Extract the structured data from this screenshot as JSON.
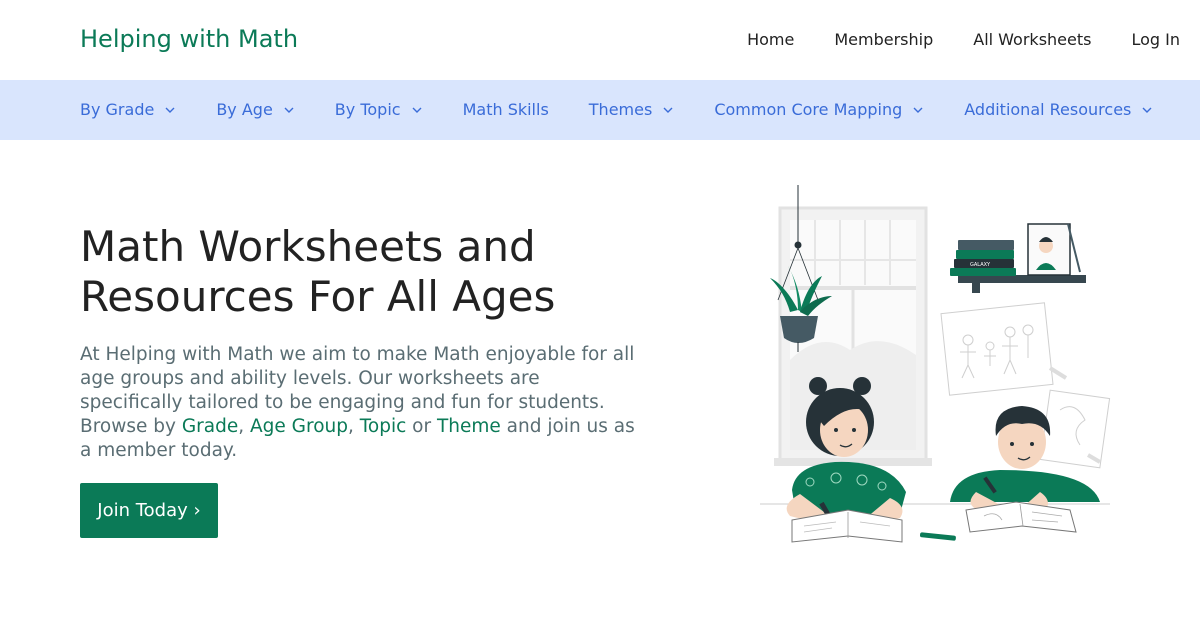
{
  "header": {
    "brand": "Helping with Math",
    "nav": [
      "Home",
      "Membership",
      "All Worksheets",
      "Log In"
    ]
  },
  "subnav": {
    "items": [
      {
        "label": "By Grade",
        "dropdown": true
      },
      {
        "label": "By Age",
        "dropdown": true
      },
      {
        "label": "By Topic",
        "dropdown": true
      },
      {
        "label": "Math Skills",
        "dropdown": false
      },
      {
        "label": "Themes",
        "dropdown": true
      },
      {
        "label": "Common Core Mapping",
        "dropdown": true
      },
      {
        "label": "Additional Resources",
        "dropdown": true
      }
    ]
  },
  "hero": {
    "title_line1": "Math Worksheets and",
    "title_line2": "Resources For All Ages",
    "text_intro": "At Helping with Math we aim to make Math enjoyable for all age groups and ability levels. Our worksheets are specifically tailored to be engaging and fun for students. Browse by ",
    "link_grade": "Grade",
    "sep1": ", ",
    "link_age": "Age Group",
    "sep2": ", ",
    "link_topic": "Topic",
    "sep3": " or ",
    "link_theme": "Theme",
    "text_outro": " and join us as a member today.",
    "cta_label": "Join Today ›"
  },
  "illustration": {
    "book_label": "GALAXY"
  },
  "colors": {
    "brand_green": "#0b7a57",
    "subnav_bg": "#d9e5fd",
    "subnav_link": "#3a6cd8",
    "body_text": "#5a6d73"
  }
}
